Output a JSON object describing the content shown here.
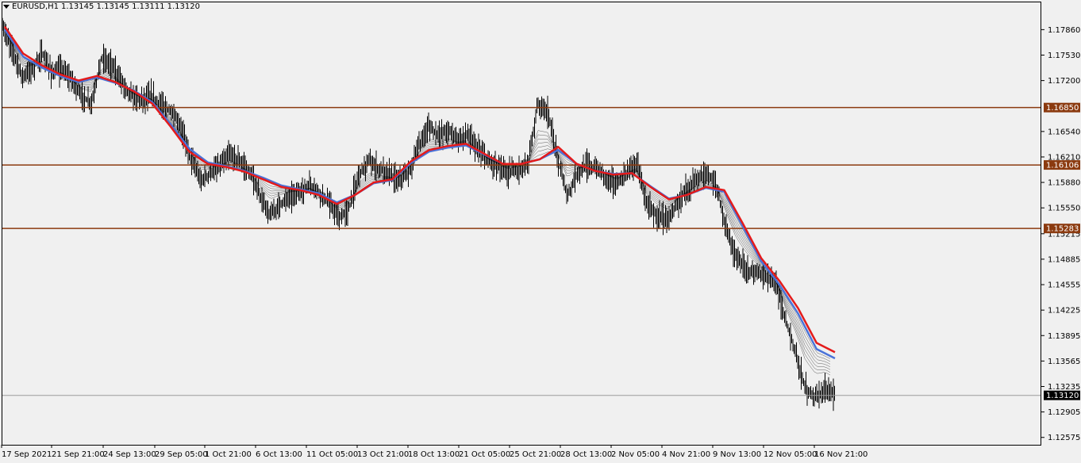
{
  "header": {
    "symbol": "EURUSD,H1",
    "values": "1.13145 1.13145 1.13111 1.13120"
  },
  "colors": {
    "background": "#f0f0f0",
    "candles": "#000000",
    "level_lines": "#8b3a0f",
    "ema_fast": "#e41b1b",
    "ema_slow": "#4a72d8",
    "ribbon": "#000000",
    "bid_line": "#9a9a9a"
  },
  "chart_data": {
    "type": "line",
    "title": "EURUSD,H1",
    "ylim": [
      1.1249,
      1.1809
    ],
    "y_ticks": [
      "1.17860",
      "1.17530",
      "1.17200",
      "1.16540",
      "1.16210",
      "1.15880",
      "1.15550",
      "1.15215",
      "1.14885",
      "1.14555",
      "1.14225",
      "1.13895",
      "1.13565",
      "1.13235",
      "1.12905",
      "1.12575"
    ],
    "x_ticks": [
      "17 Sep 2021",
      "21 Sep 21:00",
      "24 Sep 13:00",
      "29 Sep 05:00",
      "1 Oct 21:00",
      "6 Oct 13:00",
      "11 Oct 05:00",
      "13 Oct 21:00",
      "18 Oct 13:00",
      "21 Oct 05:00",
      "25 Oct 21:00",
      "28 Oct 13:00",
      "2 Nov 05:00",
      "4 Nov 21:00",
      "9 Nov 13:00",
      "12 Nov 05:00",
      "16 Nov 21:00"
    ],
    "horizontal_levels": [
      {
        "value": 1.1685,
        "label": "1.16850"
      },
      {
        "value": 1.16106,
        "label": "1.16106"
      },
      {
        "value": 1.15283,
        "label": "1.15283"
      }
    ],
    "current_price": {
      "value": 1.1312,
      "label": "1.13120"
    },
    "price_path": [
      1.179,
      1.176,
      1.1725,
      1.1735,
      1.1755,
      1.173,
      1.1735,
      1.172,
      1.17,
      1.169,
      1.175,
      1.174,
      1.172,
      1.17,
      1.1695,
      1.17,
      1.1688,
      1.168,
      1.166,
      1.162,
      1.159,
      1.16,
      1.161,
      1.1625,
      1.1615,
      1.16,
      1.157,
      1.1545,
      1.156,
      1.157,
      1.1575,
      1.1585,
      1.1575,
      1.156,
      1.154,
      1.1555,
      1.16,
      1.1615,
      1.1605,
      1.16,
      1.159,
      1.16,
      1.1635,
      1.166,
      1.165,
      1.1655,
      1.1645,
      1.165,
      1.163,
      1.1615,
      1.161,
      1.16,
      1.1605,
      1.161,
      1.169,
      1.168,
      1.162,
      1.157,
      1.16,
      1.161,
      1.1605,
      1.1595,
      1.1585,
      1.16,
      1.1615,
      1.156,
      1.1545,
      1.154,
      1.156,
      1.158,
      1.159,
      1.16,
      1.1585,
      1.153,
      1.149,
      1.1475,
      1.147,
      1.1465,
      1.146,
      1.141,
      1.137,
      1.132,
      1.131,
      1.132,
      1.1312
    ],
    "series": [
      {
        "values": [
          1.179,
          1.1755,
          1.174,
          1.1728,
          1.172,
          1.1726,
          1.1718,
          1.1706,
          1.169,
          1.166,
          1.1628,
          1.1612,
          1.1608,
          1.1602,
          1.1592,
          1.1582,
          1.1578,
          1.1572,
          1.156,
          1.1572,
          1.1588,
          1.1592,
          1.1615,
          1.163,
          1.1635,
          1.1638,
          1.1625,
          1.1612,
          1.1612,
          1.1618,
          1.1634,
          1.1612,
          1.1603,
          1.1598,
          1.16,
          1.1582,
          1.1566,
          1.1572,
          1.1582,
          1.1578,
          1.1535,
          1.149,
          1.146,
          1.1425,
          1.138,
          1.1368
        ]
      },
      {
        "values": [
          1.1786,
          1.1751,
          1.1737,
          1.1726,
          1.1718,
          1.1724,
          1.1717,
          1.1707,
          1.1692,
          1.1663,
          1.1632,
          1.1614,
          1.1609,
          1.1603,
          1.1594,
          1.1584,
          1.1579,
          1.1574,
          1.1562,
          1.1572,
          1.1587,
          1.1591,
          1.1613,
          1.1628,
          1.1633,
          1.1636,
          1.1624,
          1.1612,
          1.1612,
          1.1618,
          1.163,
          1.1612,
          1.1603,
          1.1599,
          1.16,
          1.1583,
          1.1567,
          1.1572,
          1.1581,
          1.1576,
          1.1531,
          1.1486,
          1.1455,
          1.1418,
          1.1372,
          1.136
        ]
      }
    ]
  }
}
